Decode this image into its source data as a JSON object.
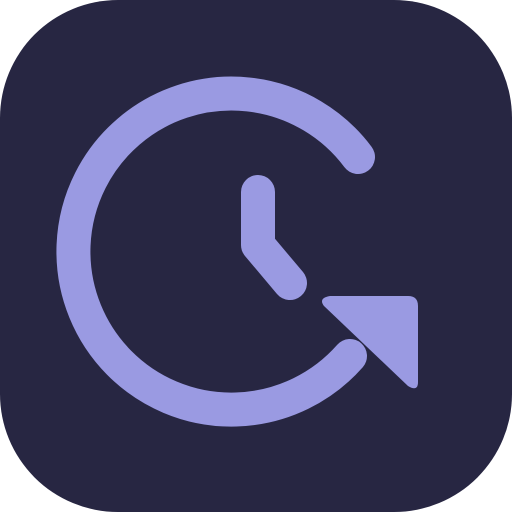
{
  "icon": {
    "name": "clock-history-icon",
    "colors": {
      "background": "#272642",
      "glyph": "#9A9AE2"
    }
  }
}
